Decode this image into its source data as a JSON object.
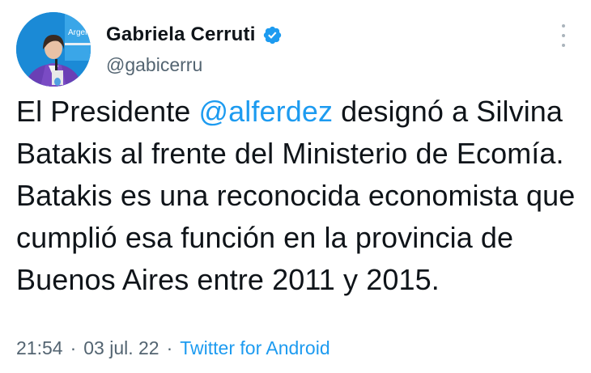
{
  "author": {
    "display_name": "Gabriela Cerruti",
    "handle": "@gabicerru",
    "verified": true,
    "avatar_text": "Argen"
  },
  "tweet": {
    "text_before": "El Presidente ",
    "mention": "@alferdez",
    "text_after": " designó a Silvina Batakis al frente del Ministerio de Ecomía. Batakis es una reconocida economista que cumplió esa función en la provincia de Buenos Aires entre 2011 y 2015."
  },
  "meta": {
    "time": "21:54",
    "separator": "·",
    "date": "03 jul. 22",
    "source": "Twitter for Android"
  },
  "colors": {
    "accent": "#1d9bf0",
    "text": "#0f1419",
    "secondary": "#536471"
  },
  "icons": {
    "verified": "verified-badge-icon",
    "more": "more-options-icon"
  }
}
